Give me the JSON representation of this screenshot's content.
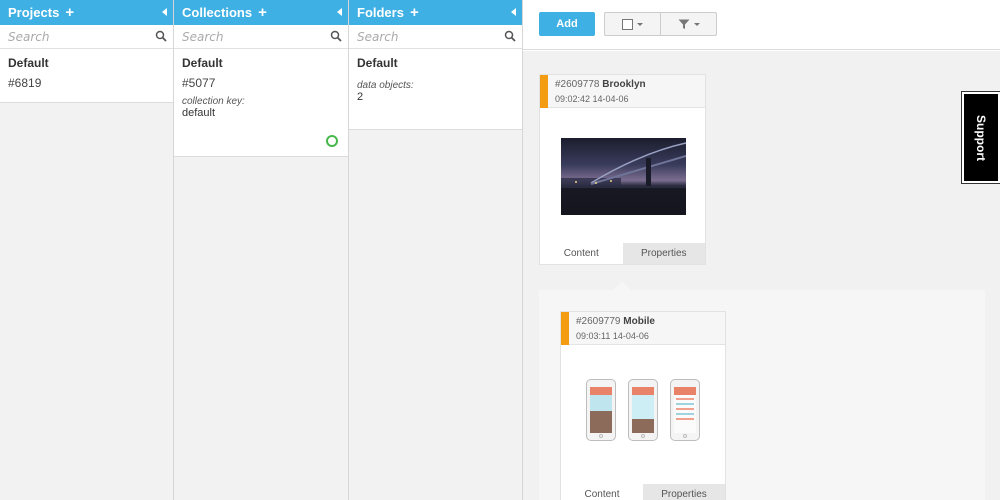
{
  "columns": [
    {
      "title": "Projects",
      "search_placeholder": "Search",
      "item": {
        "title": "Default",
        "id": "#6819"
      }
    },
    {
      "title": "Collections",
      "search_placeholder": "Search",
      "item": {
        "title": "Default",
        "id": "#5077",
        "label": "collection key:",
        "value": "default"
      }
    },
    {
      "title": "Folders",
      "search_placeholder": "Search",
      "item": {
        "title": "Default",
        "label": "data objects:",
        "value": "2"
      }
    }
  ],
  "toolbar": {
    "add_label": "Add",
    "select_icon": "checkbox-icon",
    "filter_icon": "funnel-icon"
  },
  "objects": [
    {
      "id": "#2609778",
      "name": "Brooklyn",
      "timestamp": "09:02:42 14-04-06",
      "tabs": [
        "Content",
        "Properties"
      ]
    },
    {
      "id": "#2609779",
      "name": "Mobile",
      "timestamp": "09:03:11 14-04-06",
      "tabs": [
        "Content",
        "Properties"
      ]
    }
  ],
  "support_label": "Support",
  "colors": {
    "accent": "#3fb0e4",
    "object_bar": "#f39c12",
    "status_ok": "#46b94a"
  }
}
